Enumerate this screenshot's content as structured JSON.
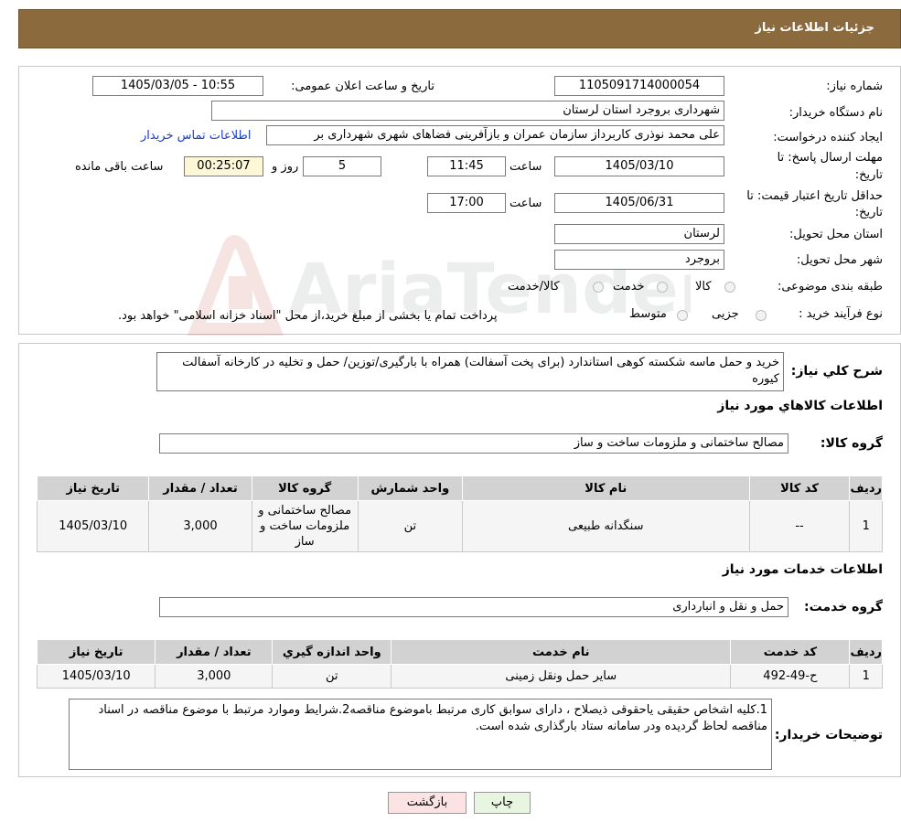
{
  "header": {
    "title": "جزئیات اطلاعات نیاز"
  },
  "info": {
    "need_number_label": "شماره نیاز:",
    "need_number": "1105091714000054",
    "announce_label": "تاریخ و ساعت اعلان عمومی:",
    "announce_value": "1405/03/05 - 10:55",
    "buyer_label": "نام دستگاه خریدار:",
    "buyer_value": "شهرداری بروجرد استان لرستان",
    "creator_label": "ایجاد کننده درخواست:",
    "creator_value": "علی محمد نوذری کاربرداز سازمان عمران و بازآفرینی فضاهای شهری شهرداری بر",
    "contact_link": "اطلاعات تماس خریدار",
    "deadline_label_1": "مهلت ارسال پاسخ: تا",
    "deadline_label_2": "تاریخ:",
    "deadline_date": "1405/03/10",
    "time_label": "ساعت",
    "deadline_time": "11:45",
    "days_value": "5",
    "days_label": "روز و",
    "remaining_time": "00:25:07",
    "remaining_label": "ساعت باقی مانده",
    "validity_label_1": "حداقل تاریخ اعتبار قیمت: تا",
    "validity_label_2": "تاریخ:",
    "validity_date": "1405/06/31",
    "validity_time": "17:00",
    "province_label": "استان محل تحویل:",
    "province_value": "لرستان",
    "city_label": "شهر محل تحویل:",
    "city_value": "بروجرد",
    "category_label": "طبقه بندی موضوعی:",
    "category_options": [
      "کالا",
      "خدمت",
      "کالا/خدمت"
    ],
    "process_label": "نوع فرآیند خرید :",
    "process_options": [
      "جزیی",
      "متوسط"
    ],
    "payment_note": "پرداخت تمام یا بخشی از مبلغ خرید،از محل \"اسناد خزانه اسلامی\" خواهد بود."
  },
  "summary": {
    "label": "شرح کلي نياز:",
    "value": "خرید و حمل ماسه شکسته کوهی استاندارد (برای پخت آسفالت) همراه با بارگیری/توزین/ حمل و تخلیه در کارخانه آسفالت کیوره"
  },
  "goods": {
    "section_title": "اطلاعات کالاهاي مورد نياز",
    "group_label": "گروه کالا:",
    "group_value": "مصالح ساختمانی و ملزومات ساخت و ساز",
    "headers": [
      "رديف",
      "کد کالا",
      "نام کالا",
      "واحد شمارش",
      "گروه کالا",
      "تعداد / مقدار",
      "تاریخ نیاز"
    ],
    "rows": [
      {
        "row": "1",
        "code": "--",
        "name": "سنگدانه طبیعی",
        "unit": "تن",
        "group": "مصالح ساختمانی و ملزومات ساخت و ساز",
        "qty": "3,000",
        "date": "1405/03/10"
      }
    ]
  },
  "services": {
    "section_title": "اطلاعات خدمات مورد نياز",
    "group_label": "گروه خدمت:",
    "group_value": "حمل و نقل و انبارداری",
    "headers": [
      "رديف",
      "کد خدمت",
      "نام خدمت",
      "واحد اندازه گيري",
      "تعداد / مقدار",
      "تاریخ نیاز"
    ],
    "rows": [
      {
        "row": "1",
        "code": "ح-49-492",
        "name": "سایر حمل ونقل زمینی",
        "unit": "تن",
        "qty": "3,000",
        "date": "1405/03/10"
      }
    ]
  },
  "buyer_notes": {
    "label": "توضیحات خریدار:",
    "value": "1.کلیه اشخاص حقیقی یاحقوقی ذیصلاح ، دارای سوابق کاری مرتبط باموضوع مناقصه2.شرایط وموارد مرتبط با موضوع مناقصه در اسناد مناقصه لحاظ گردیده ودر سامانه ستاد بارگذاری شده است."
  },
  "buttons": {
    "print": "چاپ",
    "back": "بازگشت"
  },
  "watermark": {
    "text": "AriaTender.neT"
  },
  "colors": {
    "header_bg": "#8b6a3e",
    "link": "#1a3cc8",
    "back_button_bg": "#fbe3e3",
    "print_button_bg": "#e8f5e0"
  }
}
